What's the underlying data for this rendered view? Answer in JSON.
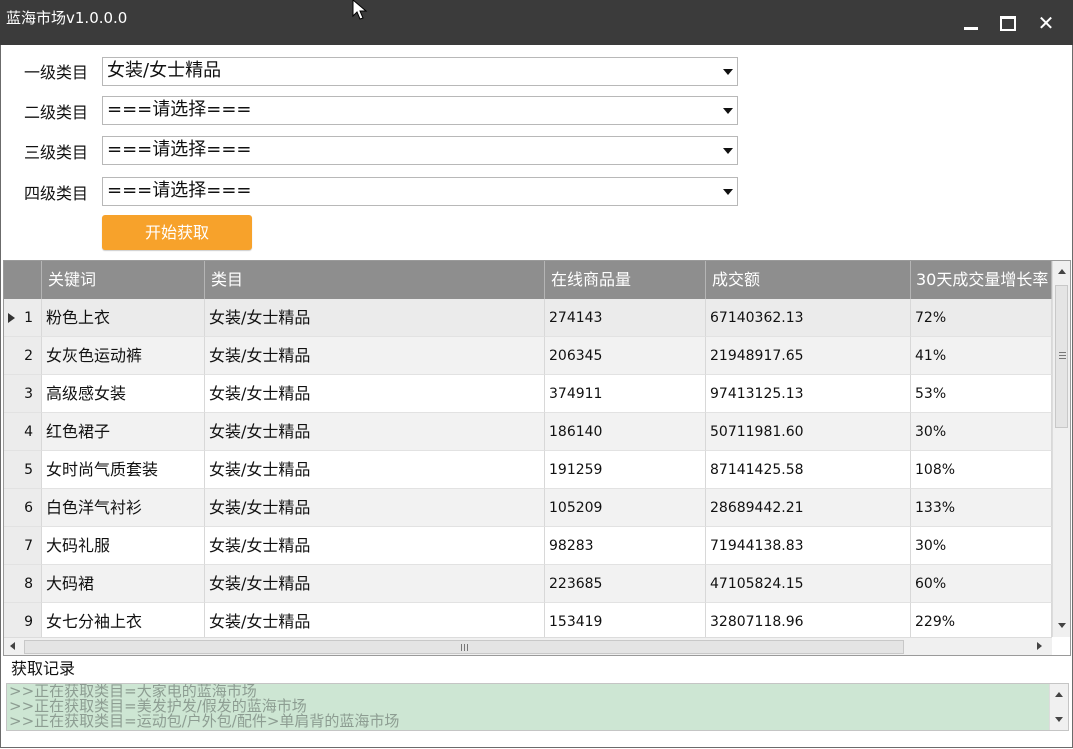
{
  "window": {
    "title": "蓝海市场v1.0.0.0",
    "minimize_icon": "minimize-icon",
    "maximize_icon": "maximize-icon",
    "close_icon": "close-icon",
    "close_glyph": "✕"
  },
  "categories": [
    {
      "label": "一级类目",
      "value": "女装/女士精品"
    },
    {
      "label": "二级类目",
      "value": "===请选择==="
    },
    {
      "label": "三级类目",
      "value": "===请选择==="
    },
    {
      "label": "四级类目",
      "value": "===请选择==="
    }
  ],
  "start_button": {
    "label": "开始获取",
    "color": "#f7a22b"
  },
  "grid": {
    "columns": [
      "关键词",
      "类目",
      "在线商品量",
      "成交额",
      "30天成交量增长率"
    ],
    "header_color": "#8e8e8e",
    "rows": [
      {
        "index": "1",
        "keyword": "粉色上衣",
        "category": "女装/女士精品",
        "online": "274143",
        "turnover": "67140362.13",
        "growth": "72%"
      },
      {
        "index": "2",
        "keyword": "女灰色运动裤",
        "category": "女装/女士精品",
        "online": "206345",
        "turnover": "21948917.65",
        "growth": "41%"
      },
      {
        "index": "3",
        "keyword": "高级感女装",
        "category": "女装/女士精品",
        "online": "374911",
        "turnover": "97413125.13",
        "growth": "53%"
      },
      {
        "index": "4",
        "keyword": "红色裙子",
        "category": "女装/女士精品",
        "online": "186140",
        "turnover": "50711981.60",
        "growth": "30%"
      },
      {
        "index": "5",
        "keyword": "女时尚气质套装",
        "category": "女装/女士精品",
        "online": "191259",
        "turnover": "87141425.58",
        "growth": "108%"
      },
      {
        "index": "6",
        "keyword": "白色洋气衬衫",
        "category": "女装/女士精品",
        "online": "105209",
        "turnover": "28689442.21",
        "growth": "133%"
      },
      {
        "index": "7",
        "keyword": "大码礼服",
        "category": "女装/女士精品",
        "online": "98283",
        "turnover": "71944138.83",
        "growth": "30%"
      },
      {
        "index": "8",
        "keyword": "大码裙",
        "category": "女装/女士精品",
        "online": "223685",
        "turnover": "47105824.15",
        "growth": "60%"
      },
      {
        "index": "9",
        "keyword": "女七分袖上衣",
        "category": "女装/女士精品",
        "online": "153419",
        "turnover": "32807118.96",
        "growth": "229%"
      }
    ]
  },
  "log": {
    "label": "获取记录",
    "background": "#cde6d3",
    "lines": [
      ">>正在获取类目=大家电的蓝海市场",
      ">>正在获取类目=美发护发/假发的蓝海市场",
      ">>正在获取类目=运动包/户外包/配件>单肩背的蓝海市场"
    ]
  }
}
